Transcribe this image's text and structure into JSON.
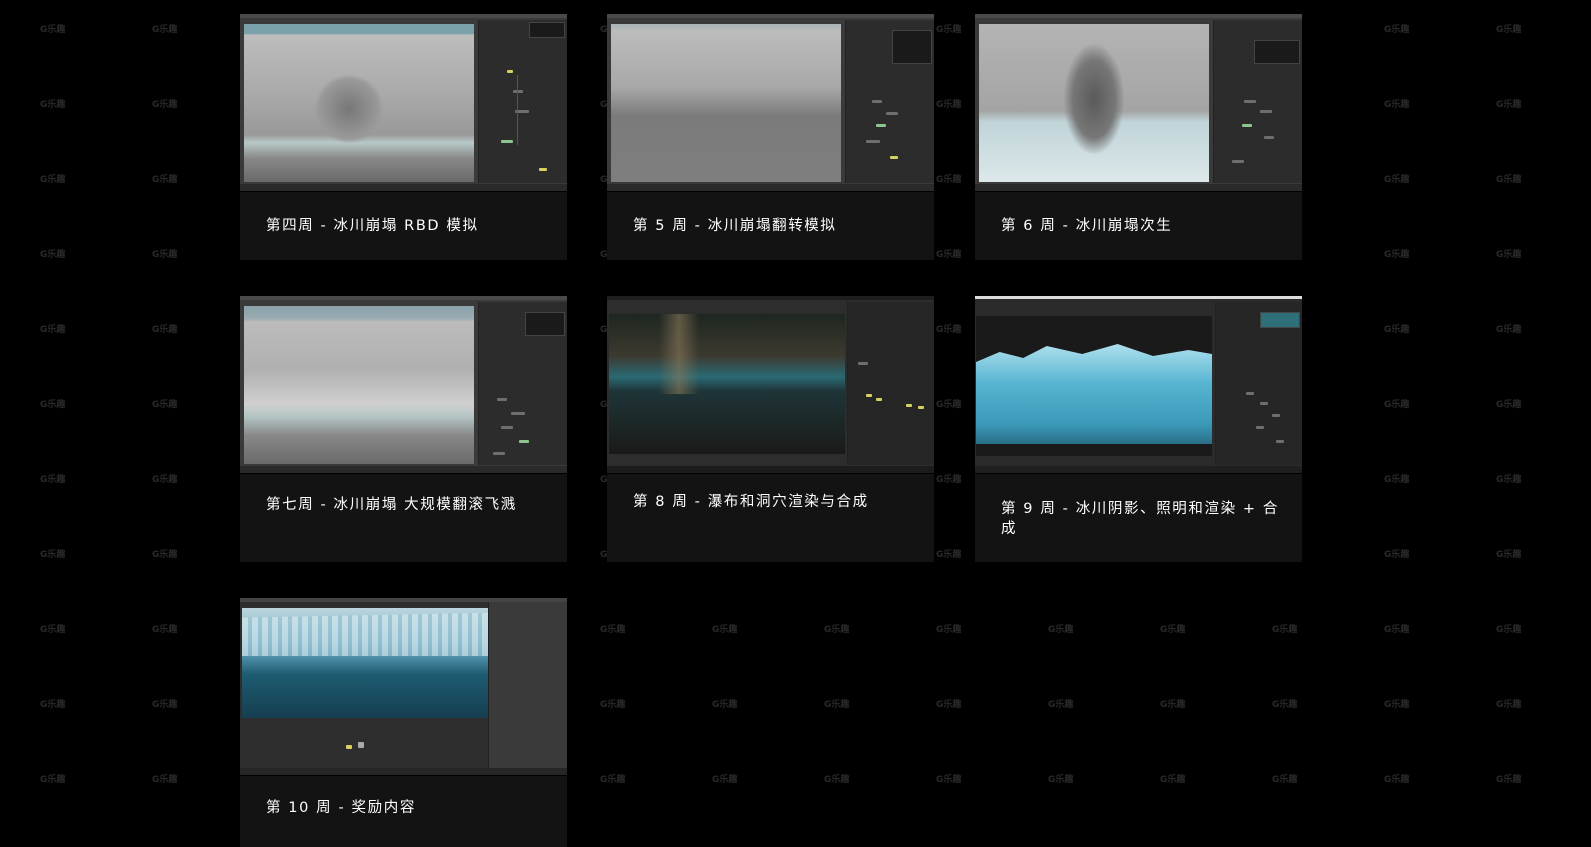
{
  "cards": [
    {
      "label": "第四周 - 冰川崩塌 RBD 模拟"
    },
    {
      "label": "第 5 周 - 冰川崩塌翻转模拟"
    },
    {
      "label": "第 6 周 - 冰川崩塌次生"
    },
    {
      "label": "第七周 - 冰川崩塌 大规模翻滚飞溅"
    },
    {
      "label": "第 8 周 - 瀑布和洞穴渲染与合成"
    },
    {
      "label": "第 9 周 - 冰川阴影、照明和渲染 + 合成"
    },
    {
      "label": "第 10 周 - 奖励内容"
    }
  ],
  "watermark": {
    "logo": "G乐趣"
  },
  "colors": {
    "background": "#000000",
    "card": "#131313",
    "caption": "#ffffff"
  }
}
